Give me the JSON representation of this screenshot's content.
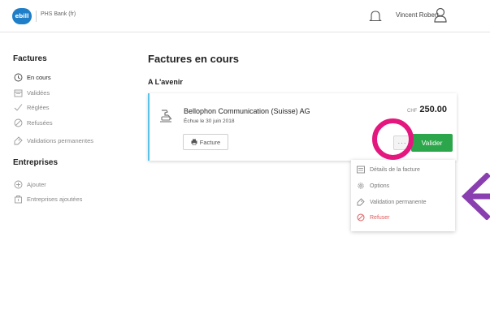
{
  "header": {
    "logo_text": "ebill",
    "bank_name": "PHS Bank (fr)",
    "user_name": "Vincent Robert"
  },
  "sidebar": {
    "factures_title": "Factures",
    "factures_items": [
      {
        "label": "En cours",
        "icon": "clock-icon",
        "active": true
      },
      {
        "label": "Validées",
        "icon": "calendar-icon",
        "active": false
      },
      {
        "label": "Réglées",
        "icon": "check-icon",
        "active": false
      },
      {
        "label": "Refusées",
        "icon": "prohibited-icon",
        "active": false
      },
      {
        "label": "Validations permanentes",
        "icon": "tag-icon",
        "active": false
      }
    ],
    "entreprises_title": "Entreprises",
    "entreprises_items": [
      {
        "label": "Ajouter",
        "icon": "plus-circle-icon"
      },
      {
        "label": "Entreprises ajoutées",
        "icon": "building-icon"
      }
    ]
  },
  "main": {
    "title": "Factures en cours",
    "section": "A L'avenir",
    "invoice": {
      "company": "Bellophon Communication (Suisse) AG",
      "due": "Échue le 30 juin 2018",
      "currency": "CHF",
      "amount": "250.00",
      "facture_label": "Facture",
      "more_label": "···",
      "valider_label": "Valider"
    },
    "menu": [
      {
        "label": "Détails de la facture",
        "icon": "list-icon",
        "danger": false
      },
      {
        "label": "Options",
        "icon": "gear-icon",
        "danger": false
      },
      {
        "label": "Validation permanente",
        "icon": "tag-icon",
        "danger": false
      },
      {
        "label": "Refuser",
        "icon": "prohibited-icon",
        "danger": true
      }
    ]
  },
  "colors": {
    "accent_blue": "#1e7ec8",
    "valider_green": "#2ca64a",
    "highlight_ring": "#e4177f",
    "arrow_purple": "#8a3fb0",
    "danger_red": "#e05a5a",
    "card_accent": "#58c2e8"
  }
}
